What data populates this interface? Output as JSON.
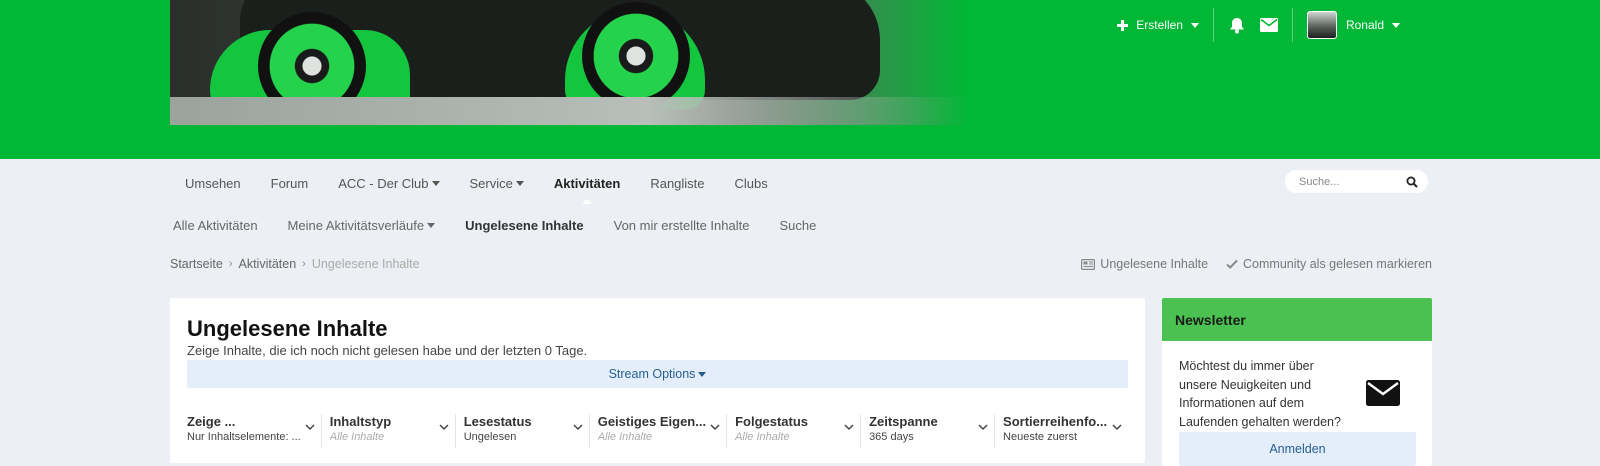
{
  "colors": {
    "header": "#00b835",
    "widget_header": "#4ac150",
    "link_blue": "#2a5d8f",
    "light_blue": "#e3eefa"
  },
  "topbar": {
    "create_label": "Erstellen",
    "user_name": "Ronald",
    "icons": [
      "plus-icon",
      "bell-icon",
      "envelope-icon"
    ]
  },
  "nav": {
    "items": [
      {
        "label": "Umsehen"
      },
      {
        "label": "Forum"
      },
      {
        "label": "ACC - Der Club"
      },
      {
        "label": "Service"
      },
      {
        "label": "Aktivitäten"
      },
      {
        "label": "Rangliste"
      },
      {
        "label": "Clubs"
      }
    ],
    "search_placeholder": "Suche..."
  },
  "subnav": {
    "items": [
      {
        "label": "Alle Aktivitäten"
      },
      {
        "label": "Meine Aktivitätsverläufe"
      },
      {
        "label": "Ungelesene Inhalte"
      },
      {
        "label": "Von mir erstellte Inhalte"
      },
      {
        "label": "Suche"
      }
    ]
  },
  "breadcrumb": {
    "items": [
      "Startseite",
      "Aktivitäten",
      "Ungelesene Inhalte"
    ],
    "actions": [
      "Ungelesene Inhalte",
      "Community als gelesen markieren"
    ]
  },
  "main": {
    "title": "Ungelesene Inhalte",
    "description": "Zeige Inhalte, die ich noch nicht gelesen habe und der letzten 0 Tage.",
    "stream_options": "Stream Options",
    "filters": [
      {
        "title": "Zeige ...",
        "value": "Nur Inhaltselemente: ..."
      },
      {
        "title": "Inhaltstyp",
        "value": "Alle Inhalte"
      },
      {
        "title": "Lesestatus",
        "value": "Ungelesen"
      },
      {
        "title": "Geistiges Eigen...",
        "value": "Alle Inhalte"
      },
      {
        "title": "Folgestatus",
        "value": "Alle Inhalte"
      },
      {
        "title": "Zeitspanne",
        "value": "365 days"
      },
      {
        "title": "Sortierreihenfo...",
        "value": "Neueste zuerst"
      }
    ]
  },
  "newsletter": {
    "title": "Newsletter",
    "text": "Möchtest du immer über unsere Neuigkeiten und Informationen auf dem Laufenden gehalten werden?",
    "button": "Anmelden"
  }
}
